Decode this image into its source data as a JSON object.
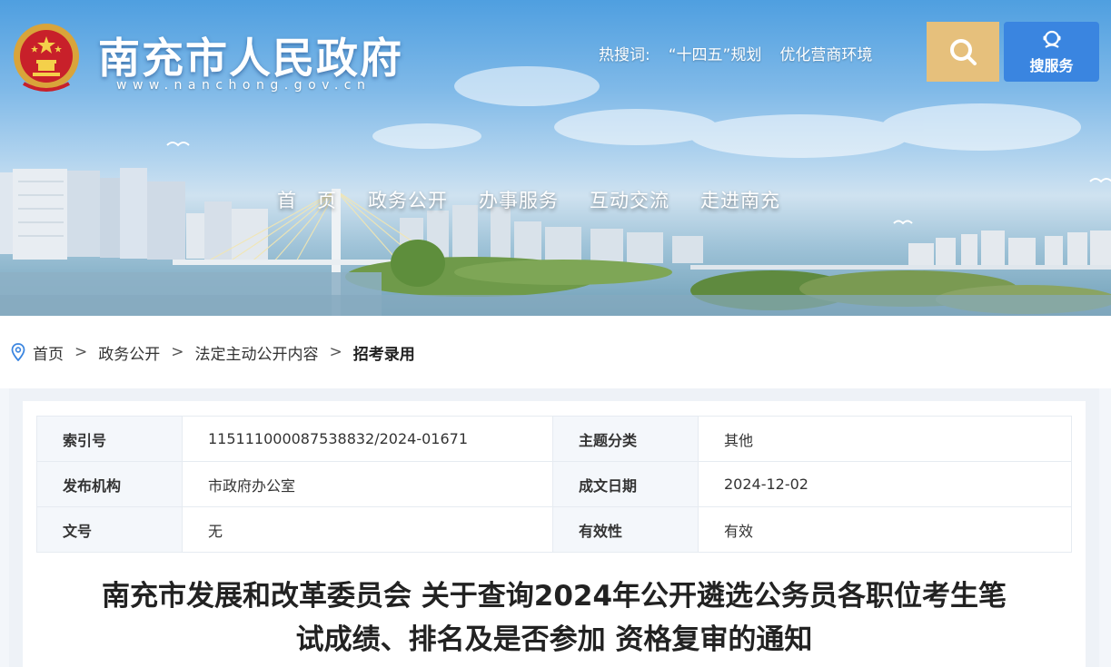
{
  "site": {
    "name": "南充市人民政府",
    "url": "www.nanchong.gov.cn"
  },
  "header": {
    "hot_label": "热搜词:",
    "hot_words": [
      "“十四五”规划",
      "优化营商环境"
    ],
    "service_label": "搜服务"
  },
  "nav": {
    "items": [
      "首　页",
      "政务公开",
      "办事服务",
      "互动交流",
      "走进南充"
    ]
  },
  "breadcrumb": {
    "items": [
      "首页",
      "政务公开",
      "法定主动公开内容"
    ],
    "current": "招考录用",
    "separator": ">"
  },
  "meta": {
    "index_no_label": "索引号",
    "index_no": "115111000087538832/2024-01671",
    "category_label": "主题分类",
    "category": "其他",
    "publisher_label": "发布机构",
    "publisher": "市政府办公室",
    "date_label": "成文日期",
    "date": "2024-12-02",
    "doc_no_label": "文号",
    "doc_no": "无",
    "validity_label": "有效性",
    "validity": "有效"
  },
  "article": {
    "title": "南充市发展和改革委员会 关于查询2024年公开遴选公务员各职位考生笔试成绩、排名及是否参加 资格复审的通知"
  },
  "colors": {
    "search_bg": "#e6c07c",
    "service_bg": "#3a85e0",
    "table_key_bg": "#f4f7fb",
    "page_bg": "#f3f6fa"
  }
}
